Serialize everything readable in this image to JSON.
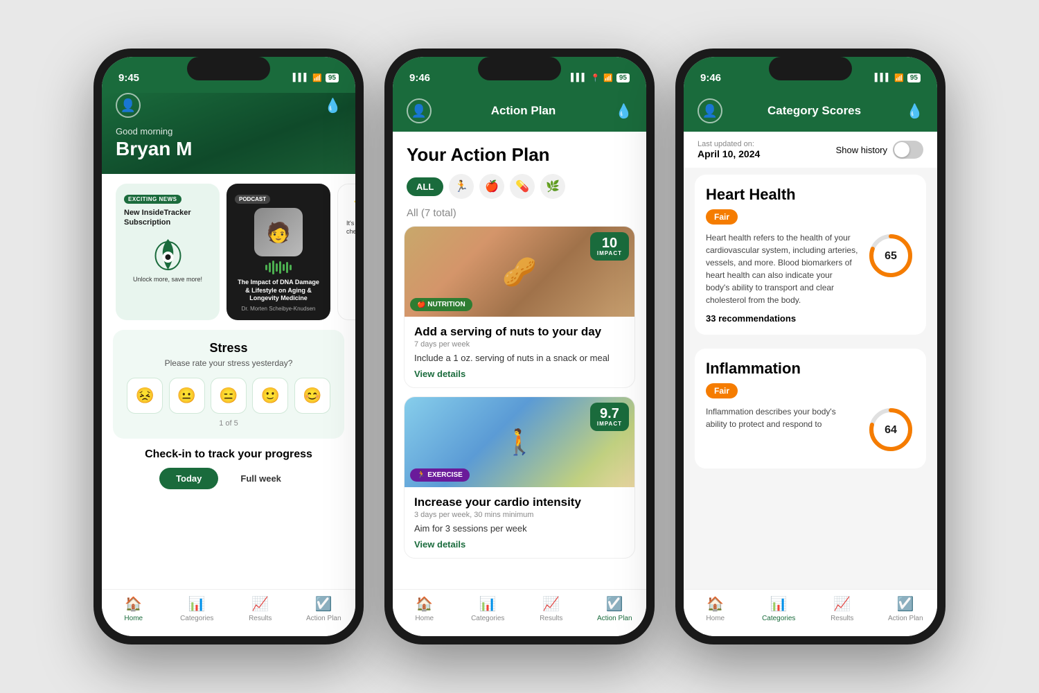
{
  "phone1": {
    "status_time": "9:45",
    "status_battery": "95",
    "greeting": "Good morning",
    "user_name": "Bryan M",
    "news_badge": "EXCITING NEWS",
    "news_title": "New InsideTracker Subscription",
    "news_subtitle": "Unlock more, save more!",
    "podcast_badge": "PODCAST",
    "podcast_title": "The Impact of DNA Damage & Lifestyle on Aging & Longevity Medicine",
    "podcast_author": "Dr. Morten Scheibye-Knudsen",
    "stress_title": "Stress",
    "stress_sub": "Please rate your stress yesterday?",
    "stress_counter": "1 of 5",
    "checkin_title": "Check-in to track your progress",
    "checkin_tab1": "Today",
    "checkin_tab2": "Full week",
    "nav_home": "Home",
    "nav_categories": "Categories",
    "nav_results": "Results",
    "nav_action": "Action Plan"
  },
  "phone2": {
    "status_time": "9:46",
    "status_battery": "95",
    "header_title": "Action Plan",
    "page_title": "Your Action Plan",
    "filter_all": "ALL",
    "all_label": "All",
    "all_count": "(7 total)",
    "card1_impact": "10",
    "card1_impact_label": "IMPACT",
    "card1_category": "🍎 NUTRITION",
    "card1_title": "Add a serving of nuts to your day",
    "card1_freq": "7 days per week",
    "card1_desc": "Include a 1 oz. serving of nuts in a snack or meal",
    "card1_link": "View details",
    "card2_impact": "9.7",
    "card2_impact_label": "IMPACT",
    "card2_category": "🏃 EXERCISE",
    "card2_title": "Increase your cardio intensity",
    "card2_freq": "3 days per week, 30 mins minimum",
    "card2_desc": "Aim for 3 sessions per week",
    "card2_link": "View details",
    "nav_home": "Home",
    "nav_categories": "Categories",
    "nav_results": "Results",
    "nav_action": "Action Plan"
  },
  "phone3": {
    "status_time": "9:46",
    "status_battery": "95",
    "header_title": "Category Scores",
    "update_label": "Last updated on:",
    "update_date": "April 10, 2024",
    "history_label": "Show history",
    "card1_title": "Heart Health",
    "card1_badge": "Fair",
    "card1_desc": "Heart health refers to the health of your cardiovascular system, including arteries, vessels, and more. Blood biomarkers of heart health can also indicate your body's ability to transport and clear cholesterol from the body.",
    "card1_score": "65",
    "card1_recommendations": "33 recommendations",
    "card2_title": "Inflammation",
    "card2_badge": "Fair",
    "card2_desc": "Inflammation describes your body's ability to protect and respond to",
    "card2_score": "64",
    "nav_home": "Home",
    "nav_categories": "Categories",
    "nav_results": "Results",
    "nav_action": "Action Plan"
  }
}
